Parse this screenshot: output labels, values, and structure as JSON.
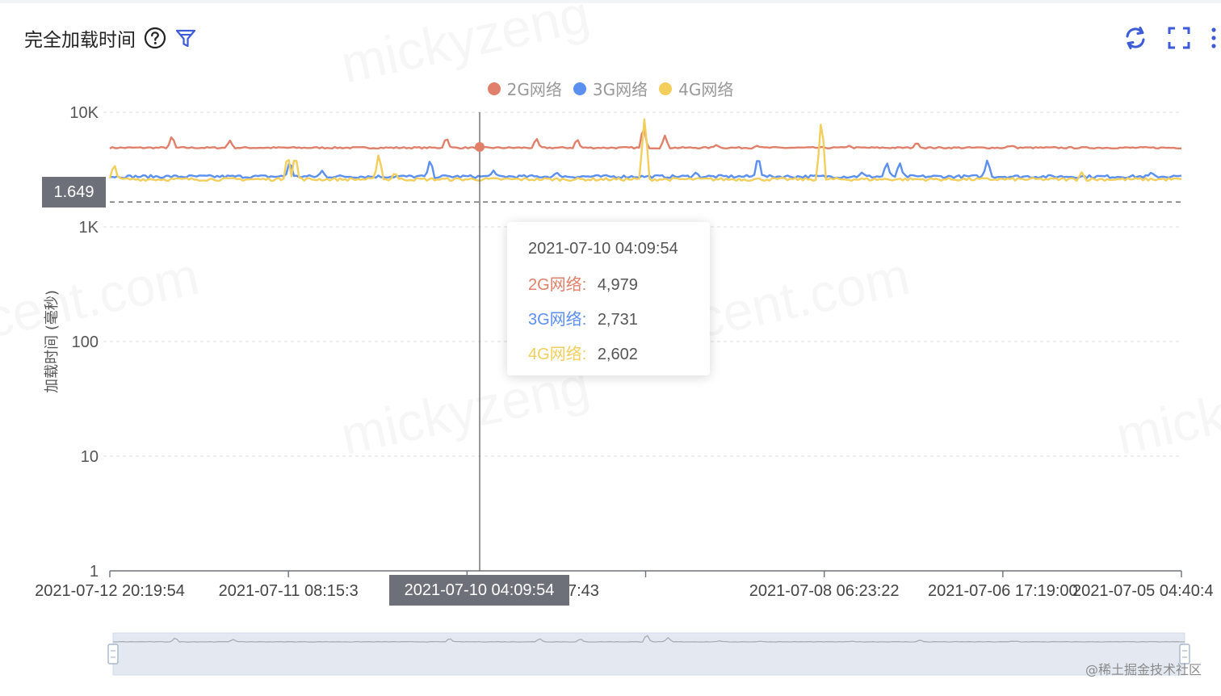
{
  "header": {
    "title": "完全加载时间",
    "help_icon": "help-circle-icon",
    "filter_icon": "filter-icon"
  },
  "toolbar": {
    "refresh_icon": "refresh-icon",
    "fullscreen_icon": "fullscreen-icon",
    "more_icon": "more-vertical-icon"
  },
  "colors": {
    "accent": "#3d5bd9",
    "series_2g": "#e0806a",
    "series_3g": "#5b8ff0",
    "series_4g": "#f2cf5c",
    "axis_pointer_bg": "#6e7079"
  },
  "tooltip": {
    "time": "2021-07-10 04:09:54",
    "rows": [
      {
        "name": "2G网络",
        "value": "4,979"
      },
      {
        "name": "3G网络",
        "value": "2,731"
      },
      {
        "name": "4G网络",
        "value": "2,602"
      }
    ]
  },
  "axis_pointer": {
    "y_label": "1.649",
    "x_label": "2021-07-10 04:09:54"
  },
  "footer": {
    "attribution": "@稀土掘金技术社区"
  },
  "watermark_text": [
    "mickyzeng",
    "cent.com"
  ],
  "chart_data": {
    "type": "line",
    "title": "完全加载时间",
    "ylabel": "加载时间 (毫秒)",
    "xlabel": "",
    "yscale": "log",
    "ylim": [
      1,
      10000
    ],
    "yticks": [
      "1",
      "10",
      "100",
      "1K",
      "10K"
    ],
    "xticks": [
      "2021-07-12 20:19:54",
      "2021-07-11 08:15:3",
      "2021-07-10 04:09:54",
      "7:43",
      "2021-07-08 06:23:22",
      "2021-07-06 17:19:00",
      "2021-07-05 04:40:4"
    ],
    "legend_position": "top-center",
    "grid": true,
    "sample_point": {
      "time": "2021-07-10 04:09:54",
      "2G网络": 4979,
      "3G网络": 2731,
      "4G网络": 2602
    },
    "series": [
      {
        "name": "2G网络",
        "baseline": 4900,
        "spikes": [
          {
            "pos": 0.058,
            "value": 6300
          },
          {
            "pos": 0.112,
            "value": 5700
          },
          {
            "pos": 0.314,
            "value": 6100
          },
          {
            "pos": 0.398,
            "value": 6000
          },
          {
            "pos": 0.436,
            "value": 5900
          },
          {
            "pos": 0.498,
            "value": 7600
          },
          {
            "pos": 0.518,
            "value": 6300
          },
          {
            "pos": 0.566,
            "value": 5200
          },
          {
            "pos": 0.604,
            "value": 5100
          },
          {
            "pos": 0.69,
            "value": 5100
          },
          {
            "pos": 0.753,
            "value": 5500
          },
          {
            "pos": 0.842,
            "value": 5100
          },
          {
            "pos": 0.839,
            "value": 5100
          },
          {
            "pos": 0.843,
            "value": 5100
          },
          {
            "pos": 0.843,
            "value": 5100
          },
          {
            "pos": 0.843,
            "value": 5100
          },
          {
            "pos": 0.843,
            "value": 5100
          },
          {
            "pos": 0.843,
            "value": 5100
          },
          {
            "pos": 0.843,
            "value": 5100
          },
          {
            "pos": 0.843,
            "value": 5100
          },
          {
            "pos": 0.843,
            "value": 5100
          },
          {
            "pos": 0.843,
            "value": 5100
          },
          {
            "pos": 0.843,
            "value": 5100
          },
          {
            "pos": 0.843,
            "value": 5100
          },
          {
            "pos": 0.843,
            "value": 5100
          },
          {
            "pos": 0.843,
            "value": 5100
          },
          {
            "pos": 0.843,
            "value": 5100
          },
          {
            "pos": 0.843,
            "value": 5100
          },
          {
            "pos": 0.843,
            "value": 5100
          },
          {
            "pos": 0.843,
            "value": 5100
          },
          {
            "pos": 0.843,
            "value": 5100
          },
          {
            "pos": 0.843,
            "value": 5100
          },
          {
            "pos": 0.843,
            "value": 5100
          },
          {
            "pos": 0.843,
            "value": 5100
          },
          {
            "pos": 0.843,
            "value": 5100
          },
          {
            "pos": 0.843,
            "value": 5100
          },
          {
            "pos": 0.843,
            "value": 5100
          },
          {
            "pos": 0.843,
            "value": 5100
          },
          {
            "pos": 0.843,
            "value": 5100
          },
          {
            "pos": 0.843,
            "value": 5100
          },
          {
            "pos": 0.843,
            "value": 5100
          },
          {
            "pos": 0.843,
            "value": 5100
          },
          {
            "pos": 0.843,
            "value": 5100
          },
          {
            "pos": 0.843,
            "value": 5100
          },
          {
            "pos": 0.843,
            "value": 5100
          },
          {
            "pos": 0.843,
            "value": 5100
          },
          {
            "pos": 0.843,
            "value": 5100
          },
          {
            "pos": 0.843,
            "value": 5100
          },
          {
            "pos": 0.843,
            "value": 5100
          },
          {
            "pos": 0.843,
            "value": 5100
          },
          {
            "pos": 0.843,
            "value": 5100
          },
          {
            "pos": 0.843,
            "value": 5100
          },
          {
            "pos": 0.843,
            "value": 5100
          },
          {
            "pos": 0.843,
            "value": 5100
          },
          {
            "pos": 0.843,
            "value": 5100
          },
          {
            "pos": 0.843,
            "value": 5100
          },
          {
            "pos": 0.843,
            "value": 5100
          },
          {
            "pos": 0.843,
            "value": 5100
          },
          {
            "pos": 0.843,
            "value": 5100
          },
          {
            "pos": 0.843,
            "value": 5100
          },
          {
            "pos": 0.843,
            "value": 5100
          },
          {
            "pos": 0.843,
            "value": 5100
          },
          {
            "pos": 0.843,
            "value": 5100
          },
          {
            "pos": 0.843,
            "value": 5100
          },
          {
            "pos": 0.843,
            "value": 5100
          },
          {
            "pos": 0.843,
            "value": 5100
          },
          {
            "pos": 0.843,
            "value": 5100
          },
          {
            "pos": 0.843,
            "value": 5100
          },
          {
            "pos": 0.843,
            "value": 5100
          },
          {
            "pos": 0.843,
            "value": 5100
          },
          {
            "pos": 0.843,
            "value": 5100
          },
          {
            "pos": 0.843,
            "value": 5100
          },
          {
            "pos": 0.843,
            "value": 5100
          },
          {
            "pos": 0.843,
            "value": 5100
          },
          {
            "pos": 0.843,
            "value": 5100
          },
          {
            "pos": 0.843,
            "value": 5100
          },
          {
            "pos": 0.843,
            "value": 5100
          },
          {
            "pos": 0.843,
            "value": 5100
          },
          {
            "pos": 0.843,
            "value": 5100
          },
          {
            "pos": 0.843,
            "value": 5100
          },
          {
            "pos": 0.843,
            "value": 5100
          },
          {
            "pos": 0.843,
            "value": 5100
          },
          {
            "pos": 0.843,
            "value": 5100
          },
          {
            "pos": 0.843,
            "value": 5100
          },
          {
            "pos": 0.843,
            "value": 5100
          },
          {
            "pos": 0.843,
            "value": 5100
          },
          {
            "pos": 0.843,
            "value": 5100
          },
          {
            "pos": 0.843,
            "value": 5100
          },
          {
            "pos": 0.843,
            "value": 5100
          },
          {
            "pos": 0.843,
            "value": 5100
          },
          {
            "pos": 0.843,
            "value": 5100
          },
          {
            "pos": 0.843,
            "value": 5100
          },
          {
            "pos": 0.843,
            "value": 5100
          },
          {
            "pos": 0.843,
            "value": 5100
          },
          {
            "pos": 0.843,
            "value": 5100
          },
          {
            "pos": 0.843,
            "value": 5100
          },
          {
            "pos": 0.843,
            "value": 5100
          },
          {
            "pos": 0.843,
            "value": 5100
          },
          {
            "pos": 0.843,
            "value": 5100
          },
          {
            "pos": 0.843,
            "value": 5100
          },
          {
            "pos": 0.843,
            "value": 5100
          }
        ]
      },
      {
        "name": "3G网络",
        "baseline": 2750,
        "spikes": [
          {
            "pos": 0.168,
            "value": 3800
          },
          {
            "pos": 0.198,
            "value": 3100
          },
          {
            "pos": 0.299,
            "value": 3900
          },
          {
            "pos": 0.358,
            "value": 3100
          },
          {
            "pos": 0.417,
            "value": 3000
          },
          {
            "pos": 0.547,
            "value": 3000
          },
          {
            "pos": 0.605,
            "value": 4200
          },
          {
            "pos": 0.702,
            "value": 3000
          },
          {
            "pos": 0.725,
            "value": 3700
          },
          {
            "pos": 0.737,
            "value": 3700
          },
          {
            "pos": 0.819,
            "value": 3900
          },
          {
            "pos": 0.972,
            "value": 3000
          }
        ]
      },
      {
        "name": "4G网络",
        "baseline": 2600,
        "spikes": [
          {
            "pos": 0.004,
            "value": 3600
          },
          {
            "pos": 0.166,
            "value": 4300
          },
          {
            "pos": 0.173,
            "value": 4300
          },
          {
            "pos": 0.251,
            "value": 4400
          },
          {
            "pos": 0.266,
            "value": 3000
          },
          {
            "pos": 0.499,
            "value": 9000
          },
          {
            "pos": 0.664,
            "value": 8600
          },
          {
            "pos": 0.907,
            "value": 3000
          }
        ]
      }
    ]
  }
}
